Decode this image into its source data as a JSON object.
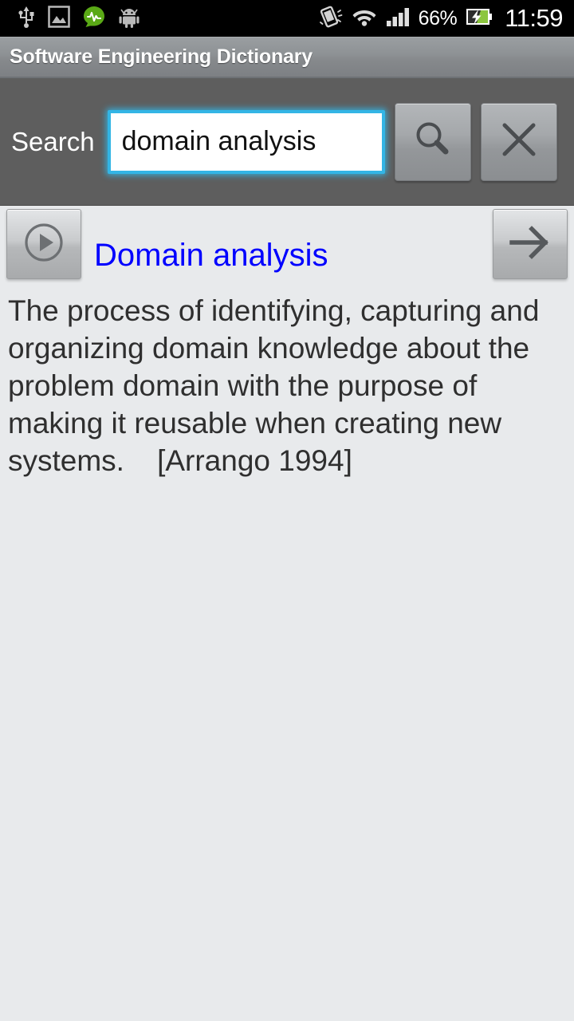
{
  "status_bar": {
    "icons_left": [
      "usb-icon",
      "screenshot-image-icon",
      "waveform-badge-icon",
      "android-robot-icon"
    ],
    "icons_right": [
      "vibrate-rotate-icon",
      "wifi-icon",
      "cellular-signal-icon",
      "battery-charging-icon"
    ],
    "battery_percent": "66%",
    "clock": "11:59",
    "background_color": "#000000",
    "text_color": "#ffffff",
    "battery_accent_color": "#8cc63f"
  },
  "title_bar": {
    "app_title": "Software Engineering Dictionary"
  },
  "search": {
    "label": "Search",
    "value": "domain analysis",
    "placeholder": "",
    "focus_color": "#33b5e5",
    "search_button_icon": "search-icon",
    "clear_button_icon": "close-icon"
  },
  "entry": {
    "play_button_icon": "play-circle-icon",
    "next_button_icon": "arrow-right-icon",
    "title": "Domain analysis",
    "title_color": "#0000ff",
    "definition": "The process of identifying, capturing and  organizing domain knowledge about the problem domain with the purpose of making it reusable when creating new systems.    [Arrango 1994]"
  },
  "theme": {
    "content_background": "#e8eaec",
    "search_bar_background": "#5e5e5e",
    "title_bar_text": "#ffffff"
  }
}
